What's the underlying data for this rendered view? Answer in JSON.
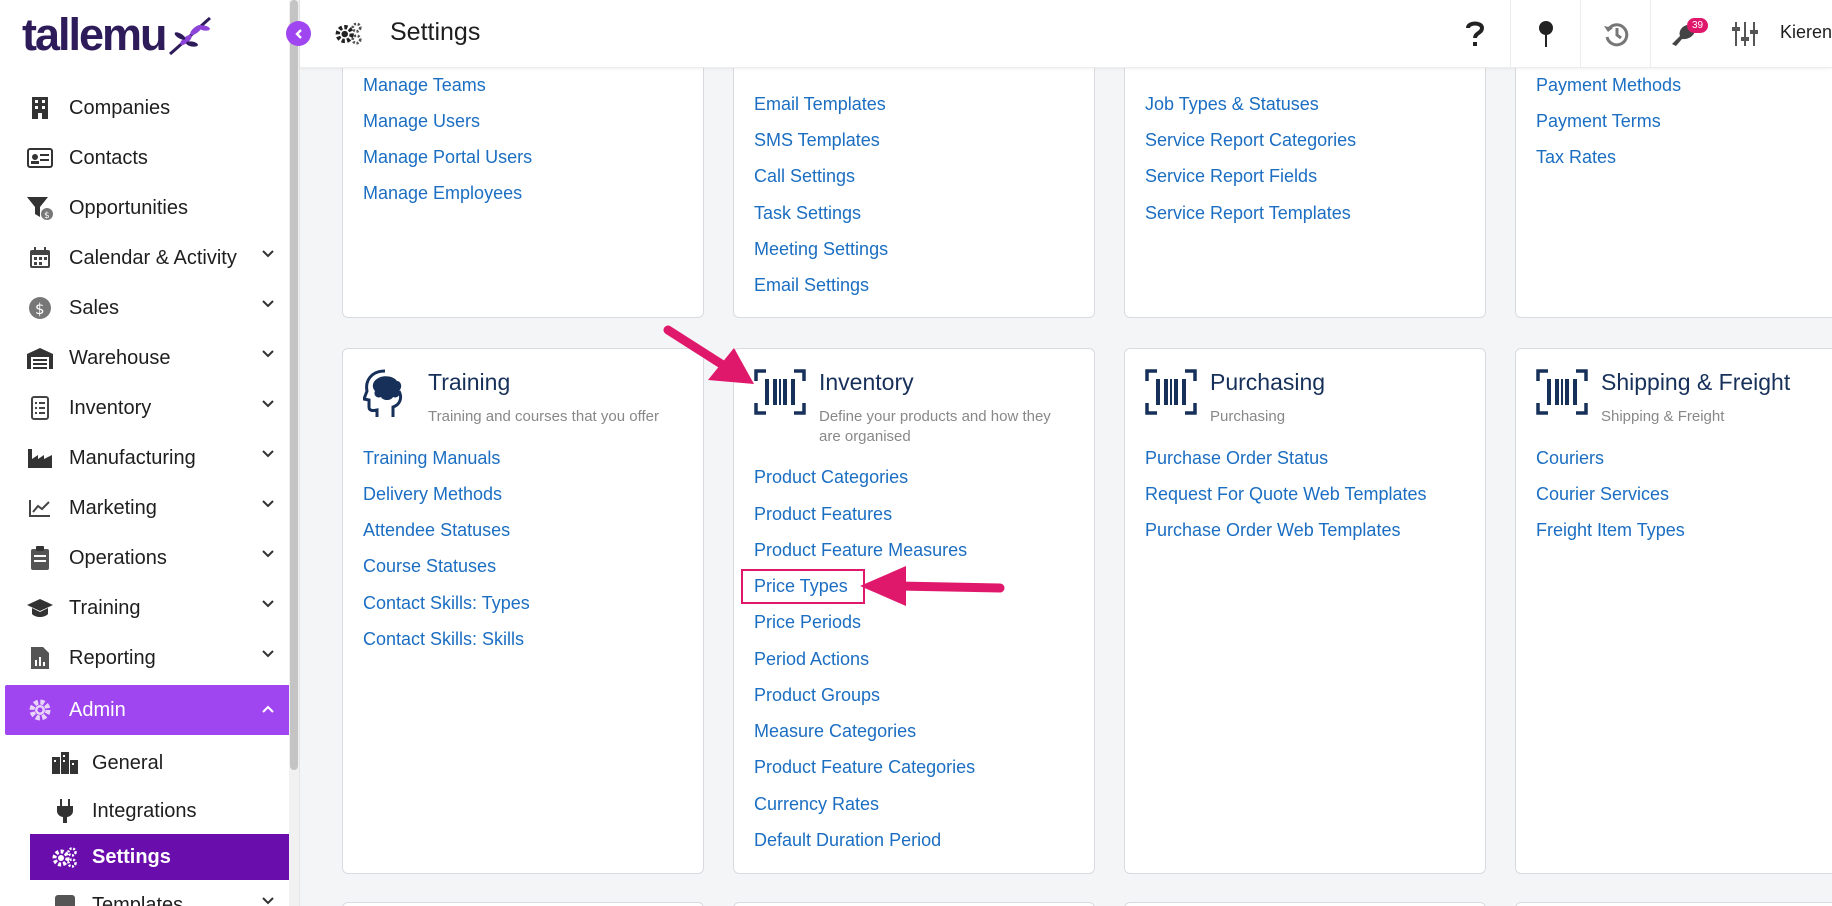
{
  "brand": {
    "name": "tallemu"
  },
  "header": {
    "title": "Settings",
    "notifications_count": "39",
    "user_name": "Kieren"
  },
  "sidebar": {
    "items": [
      {
        "label": "Companies",
        "icon": "building-icon"
      },
      {
        "label": "Contacts",
        "icon": "contact-card-icon"
      },
      {
        "label": "Opportunities",
        "icon": "funnel-icon"
      },
      {
        "label": "Calendar & Activity",
        "icon": "calendar-icon"
      },
      {
        "label": "Sales",
        "icon": "dollar-icon"
      },
      {
        "label": "Warehouse",
        "icon": "warehouse-icon"
      },
      {
        "label": "Inventory",
        "icon": "list-icon"
      },
      {
        "label": "Manufacturing",
        "icon": "factory-icon"
      },
      {
        "label": "Marketing",
        "icon": "chart-line-icon"
      },
      {
        "label": "Operations",
        "icon": "clipboard-icon"
      },
      {
        "label": "Training",
        "icon": "graduation-cap-icon"
      },
      {
        "label": "Reporting",
        "icon": "report-icon"
      },
      {
        "label": "Admin",
        "icon": "gear-icon"
      }
    ],
    "admin_sub": [
      {
        "label": "General",
        "icon": "city-icon"
      },
      {
        "label": "Integrations",
        "icon": "plug-icon"
      },
      {
        "label": "Settings",
        "icon": "gears-icon"
      },
      {
        "label": "Templates",
        "icon": "template-icon"
      }
    ]
  },
  "cards_top": {
    "col1": {
      "links": [
        "Manage Teams",
        "Manage Users",
        "Manage Portal Users",
        "Manage Employees"
      ]
    },
    "col2": {
      "links": [
        "Email Templates",
        "SMS Templates",
        "Call Settings",
        "Task Settings",
        "Meeting Settings",
        "Email Settings"
      ]
    },
    "col3": {
      "links": [
        "Job Types & Statuses",
        "Service Report Categories",
        "Service Report Fields",
        "Service Report Templates"
      ]
    },
    "col4": {
      "links": [
        "Payment Methods",
        "Payment Terms",
        "Tax Rates"
      ]
    }
  },
  "cards": {
    "training": {
      "title": "Training",
      "subtitle": "Training and courses that you offer",
      "icon": "brain-head-icon",
      "links": [
        "Training Manuals",
        "Delivery Methods",
        "Attendee Statuses",
        "Course Statuses",
        "Contact Skills: Types",
        "Contact Skills: Skills"
      ]
    },
    "inventory": {
      "title": "Inventory",
      "subtitle": "Define your products and how they are organised",
      "icon": "barcode-icon",
      "links": [
        "Product Categories",
        "Product Features",
        "Product Feature Measures",
        "Price Types",
        "Price Periods",
        "Period Actions",
        "Product Groups",
        "Measure Categories",
        "Product Feature Categories",
        "Currency Rates",
        "Default Duration Period"
      ]
    },
    "purchasing": {
      "title": "Purchasing",
      "subtitle": "Purchasing",
      "icon": "barcode-icon",
      "links": [
        "Purchase Order Status",
        "Request For Quote Web Templates",
        "Purchase Order Web Templates"
      ]
    },
    "shipping": {
      "title": "Shipping & Freight",
      "subtitle": "Shipping & Freight",
      "icon": "barcode-icon",
      "links": [
        "Couriers",
        "Courier Services",
        "Freight Item Types"
      ]
    }
  },
  "colors": {
    "accent": "#a046f0",
    "active": "#6a0dad",
    "link": "#1b6ec2",
    "annotation": "#e0186c",
    "title": "#17305a"
  }
}
